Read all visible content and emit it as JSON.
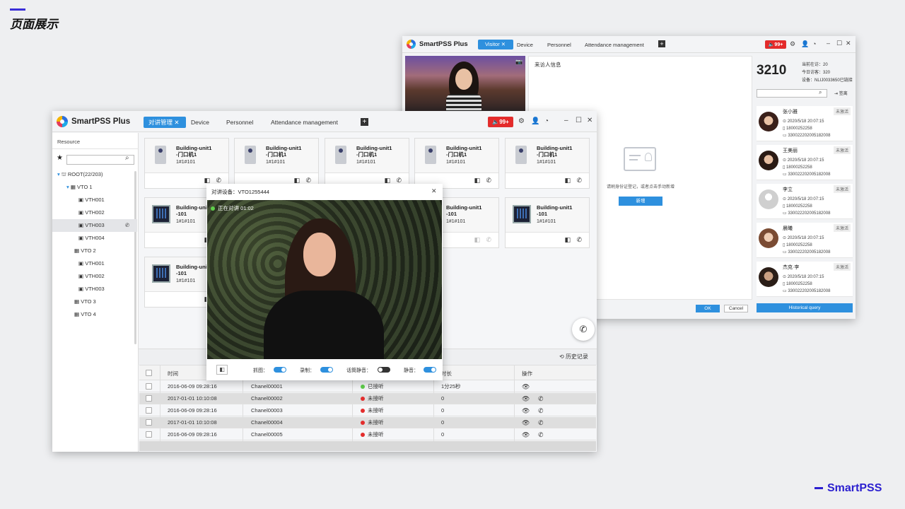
{
  "page": {
    "title": "页面展示",
    "brand": "SmartPSS"
  },
  "visitor_window": {
    "app": "SmartPSS Plus",
    "tabs": [
      "Visitor",
      "Device",
      "Personnel",
      "Attendance management"
    ],
    "badge": "99+",
    "info_title": "来访人信息",
    "count": "3210",
    "stats": [
      "当前在访：20",
      "今日访客：320",
      "设备：NLIJ0033650已链接"
    ],
    "register_label": "签离",
    "empty_hint": "请刷身份证登记，或者点击手动新增",
    "add_label": "新增",
    "ok_label": "OK",
    "cancel_label": "Cancel",
    "history_label": "Historical query",
    "visitors": [
      {
        "name": "张小雅",
        "status": "未激活",
        "time": "2020/5/18  20:07:15",
        "phone": "18000252258",
        "id": "330022202005182008"
      },
      {
        "name": "王美丽",
        "status": "未激活",
        "time": "2020/5/18  20:07:15",
        "phone": "18000252258",
        "id": "330022202005182008"
      },
      {
        "name": "李立",
        "status": "未激活",
        "time": "2020/5/18  20:07:15",
        "phone": "18000252258",
        "id": "330022202005182008"
      },
      {
        "name": "晨曦",
        "status": "未激活",
        "time": "2020/5/18  20:07:15",
        "phone": "18000252258",
        "id": "330022202005182008"
      },
      {
        "name": "杰克·李",
        "status": "未激活",
        "time": "2020/5/18  20:07:15",
        "phone": "18000252258",
        "id": "330022202005182008"
      }
    ]
  },
  "main_window": {
    "app": "SmartPSS Plus",
    "tabs": [
      "对讲管理",
      "Device",
      "Personnel",
      "Attendance management"
    ],
    "badge": "99+",
    "sidebar": {
      "title": "Resource",
      "tree": [
        {
          "label": "ROOT(22/203)"
        },
        {
          "label": "VTO 1"
        },
        {
          "label": "VTH001"
        },
        {
          "label": "VTH002"
        },
        {
          "label": "VTH003"
        },
        {
          "label": "VTH004"
        },
        {
          "label": "VTO 2"
        },
        {
          "label": "VTH001"
        },
        {
          "label": "VTH002"
        },
        {
          "label": "VTH003"
        },
        {
          "label": "VTO 3"
        },
        {
          "label": "VTO 4"
        }
      ]
    },
    "devices": [
      {
        "name": "Building-unit1\n-门口机1",
        "id": "1#1#101"
      },
      {
        "name": "Building-unit1\n-门口机1",
        "id": "1#1#101"
      },
      {
        "name": "Building-unit1\n-门口机1",
        "id": "1#1#101"
      },
      {
        "name": "Building-unit1\n-门口机1",
        "id": "1#1#101"
      },
      {
        "name": "Building-unit1\n-门口机1",
        "id": "1#1#101"
      },
      {
        "name": "Building-unit1\n-101",
        "id": "1#1#101"
      },
      {
        "name": "Building-unit1\n-101",
        "id": "1#1#101"
      },
      {
        "name": "Building-unit1\n-101",
        "id": "1#1#101"
      },
      {
        "name": "Building-unit1\n-101",
        "id": "1#1#101"
      }
    ],
    "history_label": "历史记录",
    "table": {
      "headers": [
        "时间",
        "",
        "",
        "时长",
        "操作"
      ],
      "rows": [
        {
          "time": "2016-06-09  09:28:16",
          "channel": "Chanel00001",
          "status": "已接听",
          "dur": "1分25秒",
          "ok": true
        },
        {
          "time": "2017-01-01  10:10:08",
          "channel": "Chanel00002",
          "status": "未接听",
          "dur": "0",
          "ok": false
        },
        {
          "time": "2016-06-09  09:28:16",
          "channel": "Chanel00003",
          "status": "未接听",
          "dur": "0",
          "ok": false
        },
        {
          "time": "2017-01-01  10:10:08",
          "channel": "Chanel00004",
          "status": "未接听",
          "dur": "0",
          "ok": false
        },
        {
          "time": "2016-06-09  09:28:16",
          "channel": "Chanel00005",
          "status": "未接听",
          "dur": "0",
          "ok": false
        }
      ]
    }
  },
  "call_dialog": {
    "title": "对讲设备：VTO1255444",
    "status": "正在对讲 01:02",
    "controls": [
      {
        "label": "抓图：",
        "on": true
      },
      {
        "label": "录制：",
        "on": true
      },
      {
        "label": "话筒静音：",
        "on": false
      },
      {
        "label": "静音：",
        "on": true
      }
    ]
  }
}
